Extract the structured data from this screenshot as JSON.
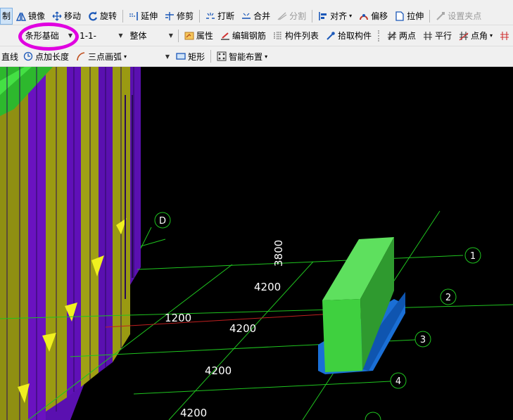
{
  "toolbar1": {
    "copy": "制",
    "mirror": "镜像",
    "move": "移动",
    "rotate": "旋转",
    "extend": "延伸",
    "trim": "修剪",
    "break": "打断",
    "merge": "合并",
    "split": "分割",
    "align": "对齐",
    "offset": "偏移",
    "stretch": "拉伸",
    "set_grip": "设置夹点"
  },
  "toolbar2": {
    "component_type": "条形基础",
    "component_name": "1-1-",
    "layer": "整体",
    "property": "属性",
    "edit_rebar": "编辑钢筋",
    "component_list": "构件列表",
    "pick_component": "拾取构件",
    "two_points": "两点",
    "parallel": "平行",
    "point_angle": "点角"
  },
  "toolbar3": {
    "line": "直线",
    "point_length": "点加长度",
    "three_point_arc": "三点画弧",
    "rectangle": "矩形",
    "smart_layout": "智能布置"
  },
  "colors": {
    "highlight_ring": "#e000e0",
    "grid_green": "#1fc41f",
    "grid_red": "#c02020",
    "footing_top": "#5ee05e",
    "footing_base": "#1a6fd6",
    "wall_purple": "#5a10b0",
    "wall_olive": "#9a9a12",
    "wall_yellow": "#f0f020"
  },
  "viewport": {
    "axis_labels": {
      "axis_d": "D",
      "axis_1": "1",
      "axis_2": "2",
      "axis_3": "3",
      "axis_4": "4"
    },
    "dims": {
      "d3800": "3800",
      "d4200_a": "4200",
      "d4200_b": "4200",
      "d4200_c": "4200",
      "d4200_d": "4200",
      "d1200": "1200"
    }
  }
}
